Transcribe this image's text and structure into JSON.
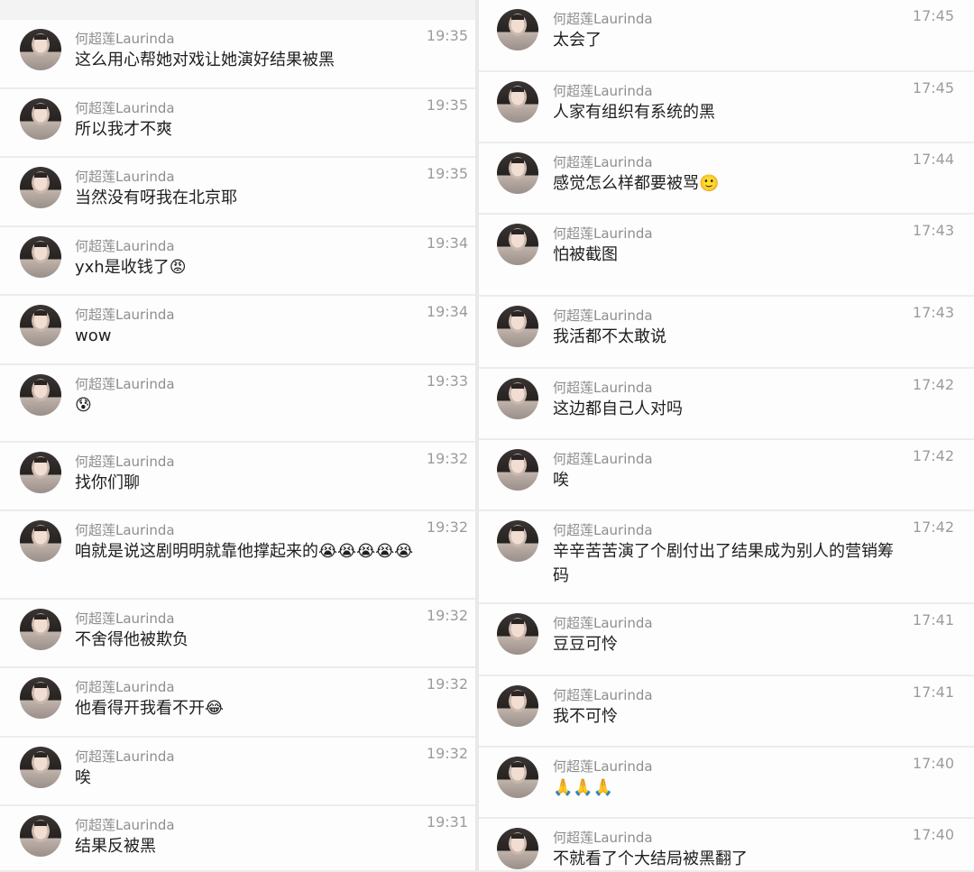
{
  "left": [
    {
      "name": "何超莲Laurinda",
      "time": "19:35",
      "text": "这么用心帮她对戏让她演好结果被黑"
    },
    {
      "name": "何超莲Laurinda",
      "time": "19:35",
      "text": "所以我才不爽"
    },
    {
      "name": "何超莲Laurinda",
      "time": "19:35",
      "text": "当然没有呀我在北京耶"
    },
    {
      "name": "何超莲Laurinda",
      "time": "19:34",
      "text": "yxh是收钱了😡"
    },
    {
      "name": "何超莲Laurinda",
      "time": "19:34",
      "text": "wow"
    },
    {
      "name": "何超莲Laurinda",
      "time": "19:33",
      "text": "😰"
    },
    {
      "name": "何超莲Laurinda",
      "time": "19:32",
      "text": "找你们聊"
    },
    {
      "name": "何超莲Laurinda",
      "time": "19:32",
      "text": "咱就是说这剧明明就靠他撑起来的😭😭😭😭😭"
    },
    {
      "name": "何超莲Laurinda",
      "time": "19:32",
      "text": "不舍得他被欺负"
    },
    {
      "name": "何超莲Laurinda",
      "time": "19:32",
      "text": "他看得开我看不开😂"
    },
    {
      "name": "何超莲Laurinda",
      "time": "19:32",
      "text": "唉"
    },
    {
      "name": "何超莲Laurinda",
      "time": "19:31",
      "text": "结果反被黑"
    }
  ],
  "right": [
    {
      "name": "何超莲Laurinda",
      "time": "17:45",
      "text": "太会了"
    },
    {
      "name": "何超莲Laurinda",
      "time": "17:45",
      "text": "人家有组织有系统的黑"
    },
    {
      "name": "何超莲Laurinda",
      "time": "17:44",
      "text": "感觉怎么样都要被骂🙂"
    },
    {
      "name": "何超莲Laurinda",
      "time": "17:43",
      "text": "怕被截图"
    },
    {
      "name": "何超莲Laurinda",
      "time": "17:43",
      "text": "我活都不太敢说"
    },
    {
      "name": "何超莲Laurinda",
      "time": "17:42",
      "text": "这边都自己人对吗"
    },
    {
      "name": "何超莲Laurinda",
      "time": "17:42",
      "text": "唉"
    },
    {
      "name": "何超莲Laurinda",
      "time": "17:42",
      "text": "辛辛苦苦演了个剧付出了结果成为别人的营销筹码"
    },
    {
      "name": "何超莲Laurinda",
      "time": "17:41",
      "text": "豆豆可怜"
    },
    {
      "name": "何超莲Laurinda",
      "time": "17:41",
      "text": "我不可怜"
    },
    {
      "name": "何超莲Laurinda",
      "time": "17:40",
      "text": "🙏🙏🙏"
    },
    {
      "name": "何超莲Laurinda",
      "time": "17:40",
      "text": "不就看了个大结局被黑翻了"
    }
  ]
}
